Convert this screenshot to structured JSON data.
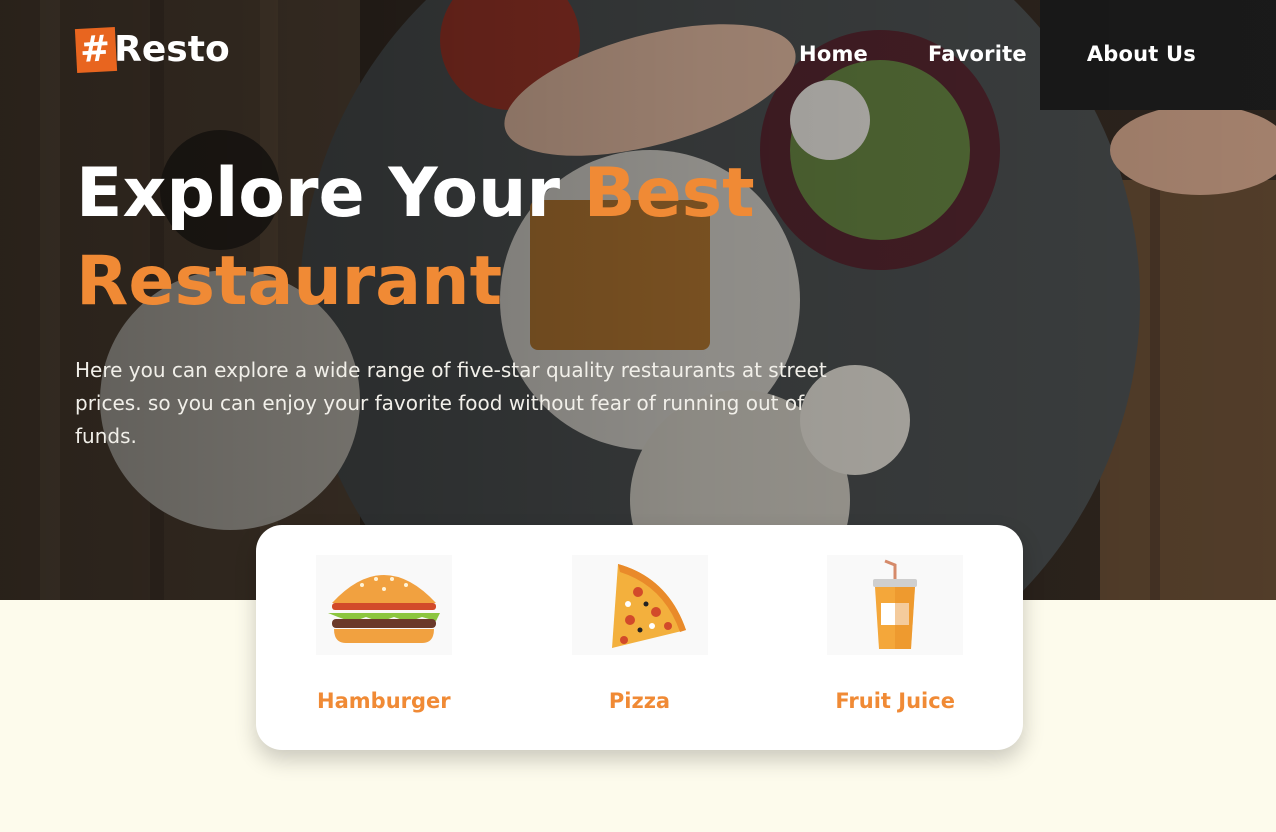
{
  "brand": {
    "hash": "#",
    "name": "Resto"
  },
  "nav": [
    {
      "label": "Home"
    },
    {
      "label": "Favorite"
    },
    {
      "label": "About Us"
    }
  ],
  "hero": {
    "title_white": "Explore Your",
    "title_accent_1": "Best",
    "title_accent_2": "Restaurant",
    "description": "Here you can explore a wide range of five-star quality restaurants at street prices. so you can enjoy your favorite food without fear of running out of funds."
  },
  "categories": [
    {
      "label": "Hamburger",
      "icon": "hamburger-icon"
    },
    {
      "label": "Pizza",
      "icon": "pizza-icon"
    },
    {
      "label": "Fruit Juice",
      "icon": "fruit-juice-icon"
    }
  ],
  "colors": {
    "accent": "#f08a35",
    "logo_bg": "#e8651f",
    "page_bg": "#fdfbec",
    "card_bg": "#ffffff"
  }
}
